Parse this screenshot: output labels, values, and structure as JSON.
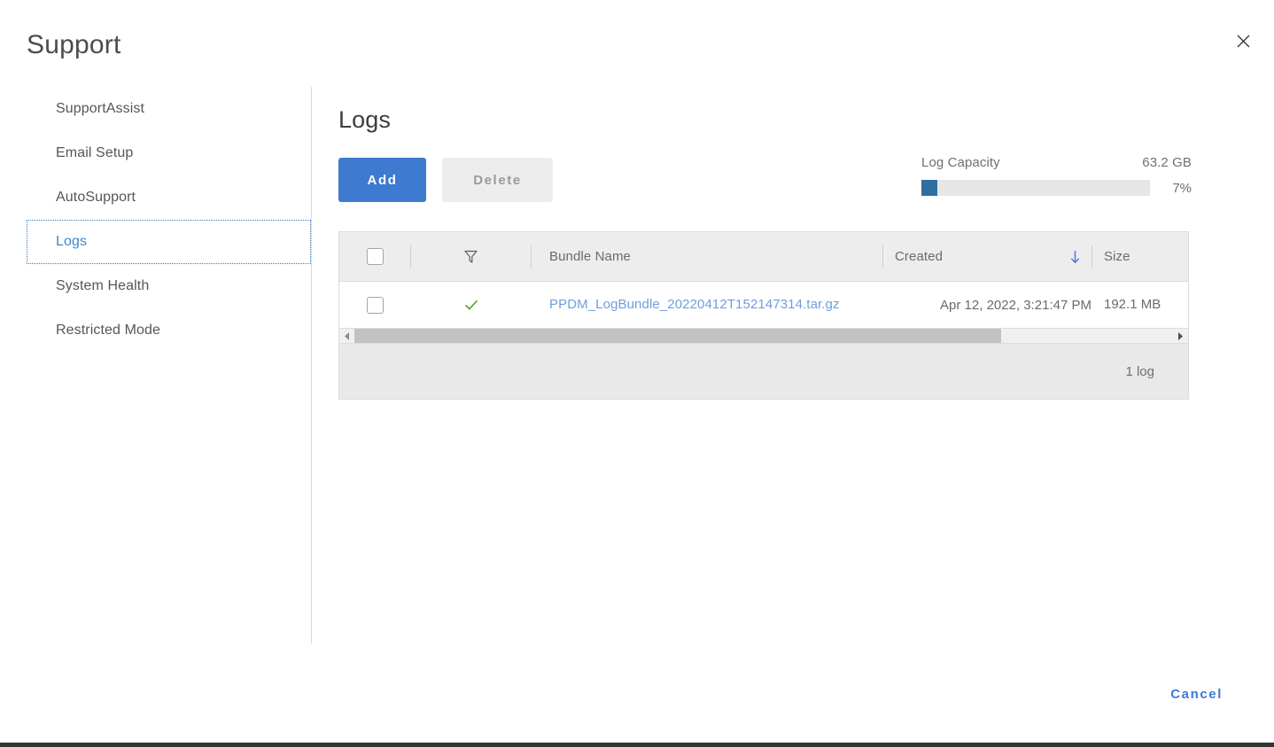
{
  "modal": {
    "title": "Support",
    "close_icon": "close-icon"
  },
  "sidebar": {
    "items": [
      {
        "label": "SupportAssist",
        "selected": false
      },
      {
        "label": "Email Setup",
        "selected": false
      },
      {
        "label": "AutoSupport",
        "selected": false
      },
      {
        "label": "Logs",
        "selected": true
      },
      {
        "label": "System Health",
        "selected": false
      },
      {
        "label": "Restricted Mode",
        "selected": false
      }
    ]
  },
  "main": {
    "title": "Logs",
    "toolbar": {
      "add_label": "Add",
      "delete_label": "Delete"
    },
    "capacity": {
      "label": "Log Capacity",
      "value": "63.2 GB",
      "percent_label": "7%",
      "percent": 7,
      "fill_color": "#2f6e9e",
      "track_color": "#e6e6e6"
    },
    "table": {
      "columns": {
        "select_all": "select-all-checkbox",
        "filter_icon": "filter-icon",
        "bundle_name": "Bundle Name",
        "created": "Created",
        "size": "Size",
        "sort_icon": "sort-descending-icon"
      },
      "rows": [
        {
          "checked": false,
          "status_icon": "check-icon",
          "bundle_name": "PPDM_LogBundle_20220412T152147314.tar.gz",
          "created": "Apr 12, 2022, 3:21:47 PM",
          "size": "192.1 MB"
        }
      ],
      "footer_count": "1 log",
      "scrollbar": {
        "left_arrow_icon": "chevron-left-icon",
        "right_arrow_icon": "chevron-right-icon",
        "thumb_percent": 79
      }
    }
  },
  "footer": {
    "cancel_label": "Cancel"
  },
  "colors": {
    "accent": "#3d7ad0",
    "link": "#6f9ede",
    "status_ok": "#3b9e14",
    "header_bg": "#ededed"
  }
}
